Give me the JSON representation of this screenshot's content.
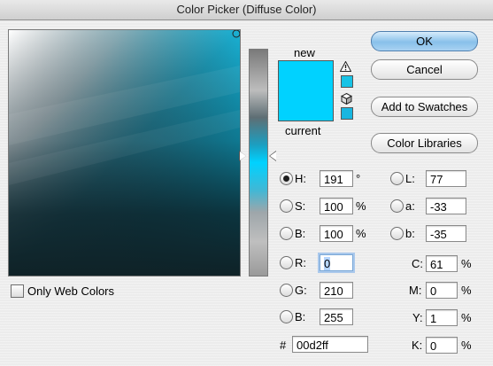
{
  "window": {
    "title": "Color Picker (Diffuse Color)"
  },
  "preview": {
    "new_label": "new",
    "current_label": "current",
    "new_color": "#00d2ff",
    "current_color": "#00d2ff"
  },
  "icons": {
    "gamut_warning": "warning-triangle-icon",
    "web_safe": "cube-icon",
    "gamut_swatch_color": "#18c3e6",
    "web_swatch_color": "#18b6e0"
  },
  "buttons": {
    "ok": "OK",
    "reset": "Cancel",
    "add_to_swatches": "Add to Swatches",
    "color_libraries": "Color Libraries"
  },
  "hsb": {
    "h": {
      "label": "H:",
      "value": "191",
      "unit": "°",
      "selected": true
    },
    "s": {
      "label": "S:",
      "value": "100",
      "unit": "%"
    },
    "b": {
      "label": "B:",
      "value": "100",
      "unit": "%"
    }
  },
  "rgb": {
    "r": {
      "label": "R:",
      "value": "0"
    },
    "g": {
      "label": "G:",
      "value": "210"
    },
    "b": {
      "label": "B:",
      "value": "255"
    }
  },
  "lab": {
    "l": {
      "label": "L:",
      "value": "77"
    },
    "a": {
      "label": "a:",
      "value": "-33"
    },
    "b": {
      "label": "b:",
      "value": "-35"
    }
  },
  "cmyk": {
    "c": {
      "label": "C:",
      "value": "61",
      "unit": "%"
    },
    "m": {
      "label": "M:",
      "value": "0",
      "unit": "%"
    },
    "y": {
      "label": "Y:",
      "value": "1",
      "unit": "%"
    },
    "k": {
      "label": "K:",
      "value": "0",
      "unit": "%"
    }
  },
  "hex": {
    "label": "#",
    "value": "00d2ff"
  },
  "options": {
    "only_web_colors": "Only Web Colors",
    "only_web_colors_checked": false
  },
  "colors": {
    "accent": "#00d2ff"
  }
}
